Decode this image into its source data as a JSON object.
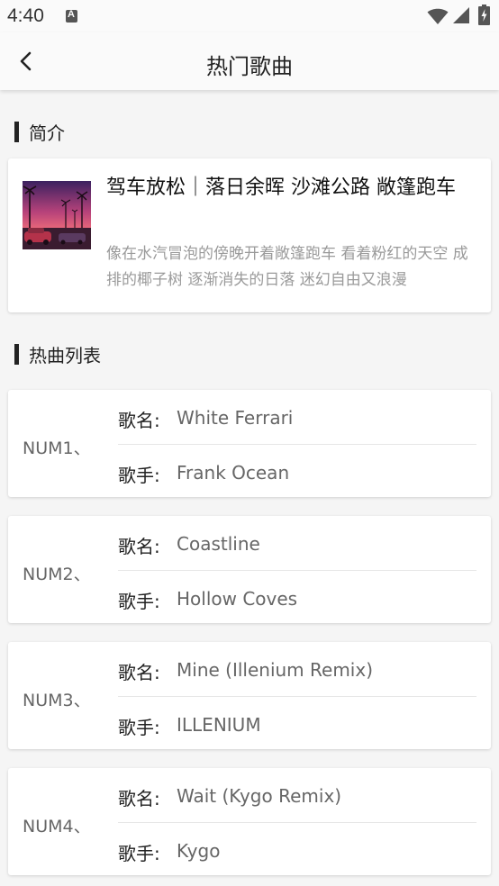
{
  "status_bar": {
    "time": "4:40"
  },
  "header": {
    "title": "热门歌曲"
  },
  "intro_section": {
    "heading": "简介",
    "title": "驾车放松｜落日余晖 沙滩公路 敞篷跑车",
    "description": "像在水汽冒泡的傍晚开着敞篷跑车 看着粉红的天空 成排的椰子树 逐渐消失的日落 迷幻自由又浪漫"
  },
  "songs_section": {
    "heading": "热曲列表",
    "name_label": "歌名:",
    "artist_label": "歌手:",
    "songs": [
      {
        "num": "NUM1、",
        "name": "White Ferrari",
        "artist": "Frank Ocean"
      },
      {
        "num": "NUM2、",
        "name": "Coastline",
        "artist": "Hollow Coves"
      },
      {
        "num": "NUM3、",
        "name": "Mine (Illenium Remix)",
        "artist": "ILLENIUM"
      },
      {
        "num": "NUM4、",
        "name": "Wait (Kygo Remix)",
        "artist": "Kygo"
      }
    ]
  }
}
